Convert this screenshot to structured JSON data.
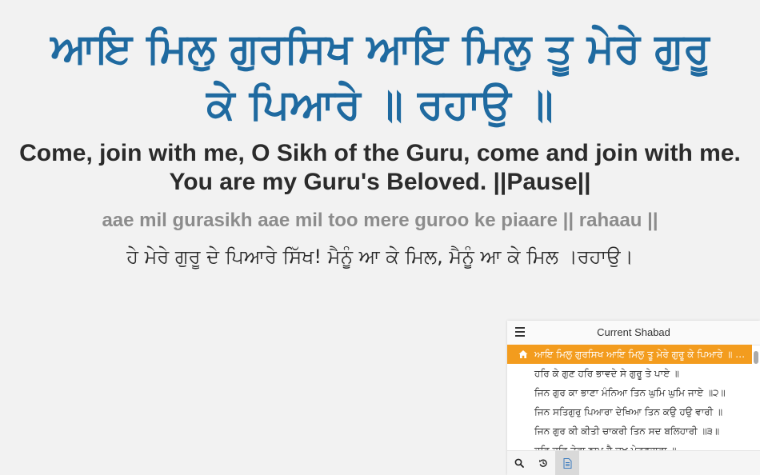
{
  "main": {
    "gurbani": "ਆਇ ਮਿਲੁ ਗੁਰਸਿਖ ਆਇ ਮਿਲੁ ਤੂ ਮੇਰੇ ਗੁਰੂ ਕੇ ਪਿਆਰੇ ॥ ਰਹਾਉ ॥",
    "translation": "Come, join with me, O Sikh of the Guru, come and join with me. You are my Guru's Beloved. ||Pause||",
    "transliteration": "aae mil gurasikh aae mil too mere guroo ke piaare || rahaau ||",
    "teeka": "ਹੇ ਮੇਰੇ ਗੁਰੂ ਦੇ ਪਿਆਰੇ ਸਿੱਖ! ਮੈਨੂੰ ਆ ਕੇ ਮਿਲ, ਮੈਨੂੰ ਆ ਕੇ ਮਿਲ ।ਰਹਾਉ।"
  },
  "panel": {
    "title": "Current Shabad",
    "lines": [
      {
        "text": "ਆਇ ਮਿਲੁ ਗੁਰਸਿਖ ਆਇ ਮਿਲੁ ਤੂ ਮੇਰੇ ਗੁਰੂ ਕੇ ਪਿਆਰੇ ॥ ਰਹਾਉ ॥",
        "active": true
      },
      {
        "text": "ਹਰਿ ਕੇ ਗੁਣ ਹਰਿ ਭਾਵਦੇ ਸੇ ਗੁਰੂ ਤੇ ਪਾਏ ॥",
        "active": false
      },
      {
        "text": "ਜਿਨ ਗੁਰ ਕਾ ਭਾਣਾ ਮੰਨਿਆ ਤਿਨ ਘੁਮਿ ਘੁਮਿ ਜਾਏ ॥੨॥",
        "active": false
      },
      {
        "text": "ਜਿਨ ਸਤਿਗੁਰੁ ਪਿਆਰਾ ਦੇਖਿਆ ਤਿਨ ਕਉ ਹਉ ਵਾਰੀ ॥",
        "active": false
      },
      {
        "text": "ਜਿਨ ਗੁਰ ਕੀ ਕੀਤੀ ਚਾਕਰੀ ਤਿਨ ਸਦ ਬਲਿਹਾਰੀ ॥੩॥",
        "active": false
      },
      {
        "text": "ਹਰਿ ਹਰਿ ਤੇਰਾ ਨਾਮੁ ਹੈ ਦੁਖ ਮੇਟਣਹਾਰਾ ॥",
        "active": false
      }
    ],
    "footer_icons": [
      "search-icon",
      "history-icon",
      "document-icon"
    ],
    "accent_color": "#f39c1e"
  },
  "colors": {
    "gurbani": "#1f6aa0",
    "translation": "#2b2b2b",
    "transliteration": "#8c8c8c",
    "background": "#f2f2f2"
  }
}
